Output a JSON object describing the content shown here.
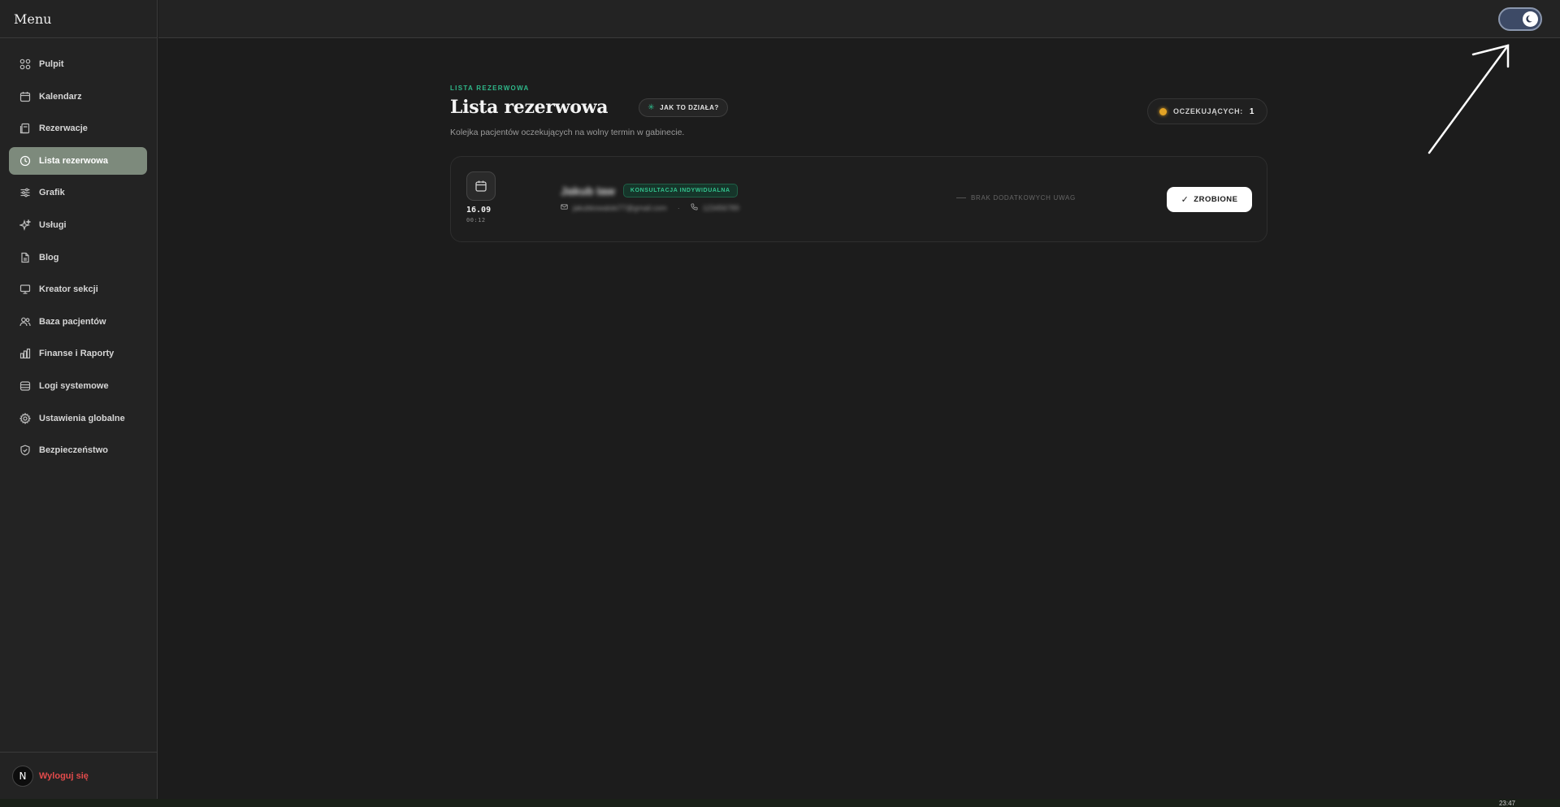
{
  "sidebar": {
    "title": "Menu",
    "items": [
      {
        "label": "Pulpit",
        "icon": "dashboard-icon",
        "active": false
      },
      {
        "label": "Kalendarz",
        "icon": "calendar-icon",
        "active": false
      },
      {
        "label": "Rezerwacje",
        "icon": "reservations-icon",
        "active": false
      },
      {
        "label": "Lista rezerwowa",
        "icon": "clock-icon",
        "active": true
      },
      {
        "label": "Grafik",
        "icon": "sliders-icon",
        "active": false
      },
      {
        "label": "Usługi",
        "icon": "sparkles-icon",
        "active": false
      },
      {
        "label": "Blog",
        "icon": "document-icon",
        "active": false
      },
      {
        "label": "Kreator sekcji",
        "icon": "monitor-icon",
        "active": false
      },
      {
        "label": "Baza pacjentów",
        "icon": "users-icon",
        "active": false
      },
      {
        "label": "Finanse i Raporty",
        "icon": "bar-chart-icon",
        "active": false
      },
      {
        "label": "Logi systemowe",
        "icon": "database-icon",
        "active": false
      },
      {
        "label": "Ustawienia globalne",
        "icon": "gear-icon",
        "active": false
      },
      {
        "label": "Bezpieczeństwo",
        "icon": "shield-icon",
        "active": false
      }
    ],
    "logout": {
      "avatar": "N",
      "label": "Wyloguj się"
    }
  },
  "topbar": {
    "theme_toggle": "dark",
    "theme_icon": "moon-icon"
  },
  "main": {
    "eyebrow": "LISTA REZERWOWA",
    "title": "Lista rezerwowa",
    "how_button": "JAK TO DZIAŁA?",
    "pending_label": "OCZEKUJĄCYCH:",
    "pending_count": "1",
    "subtitle": "Kolejka pacjentów oczekujących na wolny termin w gabinecie.",
    "entries": [
      {
        "date": "16.09",
        "time": "00:12",
        "name": "Jakub Iaw",
        "service": "KONSULTACJA INDYWIDUALNA",
        "email": "jakubkowalski77@gmail.com",
        "phone": "123456789",
        "separator": "·",
        "notes": "BRAK DODATKOWYCH UWAG",
        "done_button": "ZROBIONE"
      }
    ]
  },
  "taskbar": {
    "clock": "23:47"
  },
  "colors": {
    "accent_green": "#2fb88a",
    "active_nav": "#7d8a7c",
    "logout_red": "#e24b4b",
    "pending_dot": "#e2a325",
    "toggle_bg": "#3d4a66"
  }
}
